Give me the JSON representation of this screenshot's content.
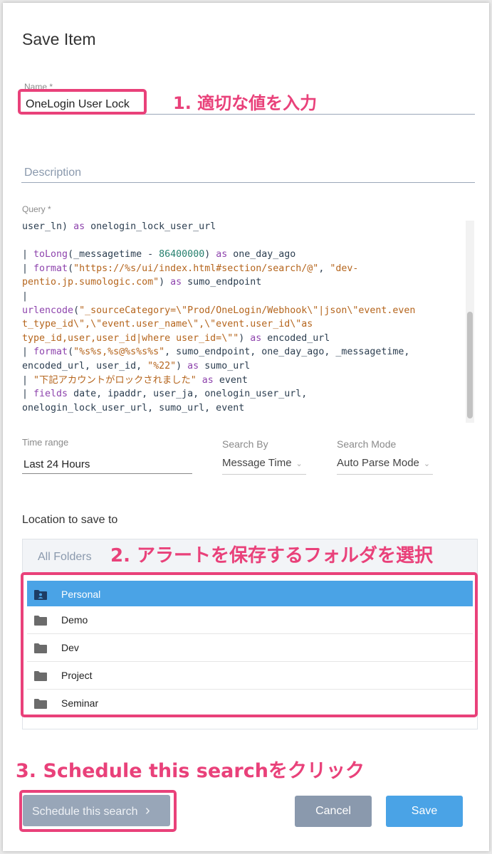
{
  "dialog": {
    "title": "Save Item",
    "name_label": "Name *",
    "name_value": "OneLogin User Lock",
    "description_placeholder": "Description",
    "query_label": "Query *",
    "query_lines": [
      [
        {
          "t": "user_ln) ",
          "c": ""
        },
        {
          "t": "as",
          "c": "kw"
        },
        {
          "t": " onelogin_lock_user_url",
          "c": ""
        }
      ],
      [
        {
          "t": "",
          "c": ""
        }
      ],
      [
        {
          "t": "| ",
          "c": ""
        },
        {
          "t": "toLong",
          "c": "kw"
        },
        {
          "t": "(_messagetime - ",
          "c": ""
        },
        {
          "t": "86400000",
          "c": "num"
        },
        {
          "t": ") ",
          "c": ""
        },
        {
          "t": "as",
          "c": "kw"
        },
        {
          "t": " one_day_ago",
          "c": ""
        }
      ],
      [
        {
          "t": "| ",
          "c": ""
        },
        {
          "t": "format",
          "c": "kw"
        },
        {
          "t": "(",
          "c": ""
        },
        {
          "t": "\"https://%s/ui/index.html#section/search/@\"",
          "c": "str"
        },
        {
          "t": ", ",
          "c": ""
        },
        {
          "t": "\"dev-",
          "c": "str"
        }
      ],
      [
        {
          "t": "pentio.jp.sumologic.com\"",
          "c": "str"
        },
        {
          "t": ") ",
          "c": ""
        },
        {
          "t": "as",
          "c": "kw"
        },
        {
          "t": " sumo_endpoint",
          "c": ""
        }
      ],
      [
        {
          "t": "|",
          "c": ""
        }
      ],
      [
        {
          "t": "urlencode",
          "c": "kw"
        },
        {
          "t": "(",
          "c": ""
        },
        {
          "t": "\"_sourceCategory=\\\"Prod/OneLogin/Webhook\\\"|json\\\"event.even",
          "c": "str"
        }
      ],
      [
        {
          "t": "t_type_id\\\",\\\"event.user_name\\\",\\\"event.user_id\\\"as",
          "c": "str"
        }
      ],
      [
        {
          "t": "type_id,user,user_id|where user_id=\\\"\"",
          "c": "str"
        },
        {
          "t": ") ",
          "c": ""
        },
        {
          "t": "as",
          "c": "kw"
        },
        {
          "t": " encoded_url",
          "c": ""
        }
      ],
      [
        {
          "t": "| ",
          "c": ""
        },
        {
          "t": "format",
          "c": "kw"
        },
        {
          "t": "(",
          "c": ""
        },
        {
          "t": "\"%s%s,%s@%s%s%s\"",
          "c": "str"
        },
        {
          "t": ", sumo_endpoint, one_day_ago, _messagetime,",
          "c": ""
        }
      ],
      [
        {
          "t": "encoded_url, user_id, ",
          "c": ""
        },
        {
          "t": "\"%22\"",
          "c": "str"
        },
        {
          "t": ") ",
          "c": ""
        },
        {
          "t": "as",
          "c": "kw"
        },
        {
          "t": " sumo_url",
          "c": ""
        }
      ],
      [
        {
          "t": "| ",
          "c": ""
        },
        {
          "t": "\"下記アカウントがロックされました\"",
          "c": "str"
        },
        {
          "t": " ",
          "c": ""
        },
        {
          "t": "as",
          "c": "kw"
        },
        {
          "t": " event",
          "c": ""
        }
      ],
      [
        {
          "t": "| ",
          "c": ""
        },
        {
          "t": "fields",
          "c": "kw"
        },
        {
          "t": " date, ipaddr, user_ja, onelogin_user_url,",
          "c": ""
        }
      ],
      [
        {
          "t": "onelogin_lock_user_url, sumo_url, event",
          "c": ""
        }
      ]
    ],
    "time_range_label": "Time range",
    "time_range_value": "Last 24 Hours",
    "search_by_label": "Search By",
    "search_by_value": "Message Time",
    "search_mode_label": "Search Mode",
    "search_mode_value": "Auto Parse Mode",
    "location_title": "Location to save to",
    "all_folders": "All Folders",
    "folders": [
      {
        "label": "Personal",
        "icon": "user-folder-icon",
        "selected": true
      },
      {
        "label": "Demo",
        "icon": "folder-icon",
        "selected": false
      },
      {
        "label": "Dev",
        "icon": "folder-icon",
        "selected": false
      },
      {
        "label": "Project",
        "icon": "folder-icon",
        "selected": false
      },
      {
        "label": "Seminar",
        "icon": "folder-icon",
        "selected": false
      }
    ],
    "schedule_button": "Schedule this search",
    "schedule_chevron": "›",
    "cancel_button": "Cancel",
    "save_button": "Save"
  },
  "annotations": {
    "step1": "1. 適切な値を入力",
    "step2": "2. アラートを保存するフォルダを選択",
    "step3": "3. Schedule this searchをクリック"
  },
  "colors": {
    "annotation": "#e9417a",
    "selected_folder": "#4aa3e6",
    "save_button": "#4aa3e6",
    "cancel_button": "#8a99ad",
    "schedule_button": "#98a6b8"
  }
}
